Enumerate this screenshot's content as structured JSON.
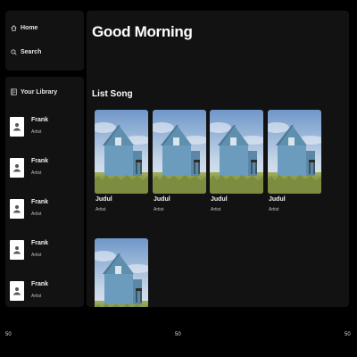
{
  "nav": {
    "home_label": "Home",
    "search_label": "Search"
  },
  "library": {
    "header": "Your Library",
    "items": [
      {
        "title": "Frank",
        "subtitle": "Artist"
      },
      {
        "title": "Frank",
        "subtitle": "Artist"
      },
      {
        "title": "Frank",
        "subtitle": "Artist"
      },
      {
        "title": "Frank",
        "subtitle": "Artist"
      },
      {
        "title": "Frank",
        "subtitle": "Artist"
      }
    ]
  },
  "main": {
    "greeting": "Good Morning",
    "section_title": "List Song",
    "songs": [
      {
        "title": "Judul",
        "subtitle": "Artist"
      },
      {
        "title": "Judul",
        "subtitle": "Artist"
      },
      {
        "title": "Judul",
        "subtitle": "Artist"
      },
      {
        "title": "Judul",
        "subtitle": "Artist"
      },
      {
        "title": "",
        "subtitle": ""
      }
    ]
  },
  "player": {
    "time_left": "50",
    "time_center": "50",
    "time_right": "50"
  },
  "colors": {
    "background": "#000000",
    "panel": "#121212"
  },
  "icons": [
    "home-icon",
    "search-icon",
    "library-icon",
    "person-icon"
  ]
}
